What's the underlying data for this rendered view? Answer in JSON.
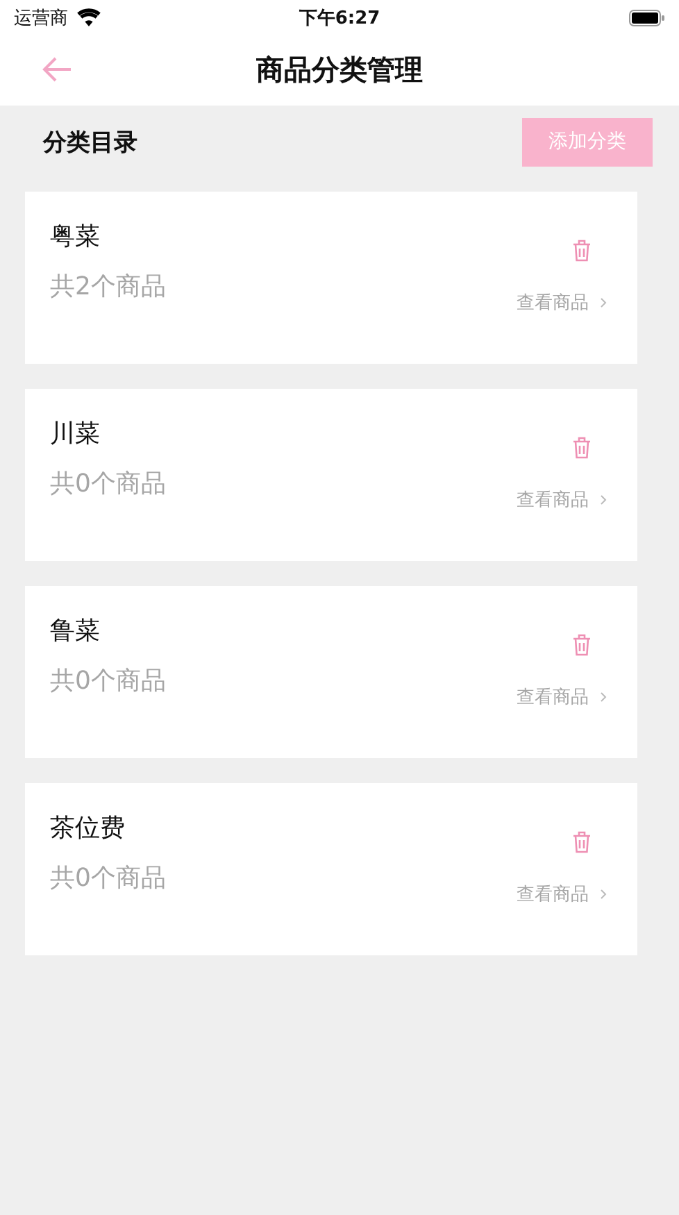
{
  "status_bar": {
    "carrier": "运营商",
    "time": "下午6:27"
  },
  "nav": {
    "title": "商品分类管理"
  },
  "header": {
    "title": "分类目录",
    "add_button": "添加分类"
  },
  "categories": [
    {
      "name": "粤菜",
      "count": "共2个商品",
      "link": "查看商品"
    },
    {
      "name": "川菜",
      "count": "共0个商品",
      "link": "查看商品"
    },
    {
      "name": "鲁菜",
      "count": "共0个商品",
      "link": "查看商品"
    },
    {
      "name": "茶位费",
      "count": "共0个商品",
      "link": "查看商品"
    }
  ]
}
